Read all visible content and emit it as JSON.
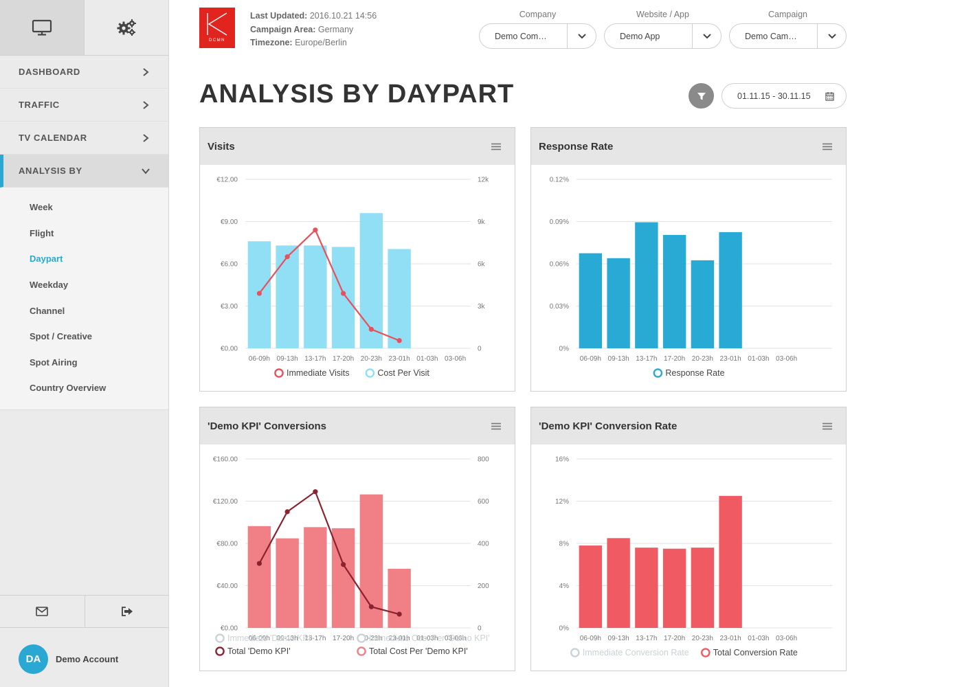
{
  "header": {
    "logo_text": "DCMN",
    "last_updated_label": "Last Updated:",
    "last_updated_value": "2016.10.21 14:56",
    "campaign_area_label": "Campaign Area:",
    "campaign_area_value": "Germany",
    "timezone_label": "Timezone:",
    "timezone_value": "Europe/Berlin",
    "selectors": [
      {
        "label": "Company",
        "value": "Demo Com…"
      },
      {
        "label": "Website / App",
        "value": "Demo App"
      },
      {
        "label": "Campaign",
        "value": "Demo Cam…"
      }
    ],
    "page_title": "ANALYSIS BY DAYPART",
    "date_range": "01.11.15 - 30.11.15"
  },
  "sidebar": {
    "nav": [
      {
        "label": "DASHBOARD"
      },
      {
        "label": "TRAFFIC"
      },
      {
        "label": "TV CALENDAR"
      },
      {
        "label": "ANALYSIS BY"
      }
    ],
    "sub": [
      "Week",
      "Flight",
      "Daypart",
      "Weekday",
      "Channel",
      "Spot / Creative",
      "Spot Airing",
      "Country Overview"
    ],
    "account_initials": "DA",
    "account_name": "Demo Account"
  },
  "colors": {
    "accent": "#29a8d4",
    "light_blue": "#90dff5",
    "blue": "#29aad4",
    "red_line": "#e8505b",
    "pink": "#f07f86",
    "dark_red": "#8b2230",
    "red": "#f05a63"
  },
  "chart_data": [
    {
      "type": "bar",
      "title": "Visits",
      "categories": [
        "06-09h",
        "09-13h",
        "13-17h",
        "17-20h",
        "20-23h",
        "23-01h",
        "01-03h",
        "03-06h"
      ],
      "yticks_left": [
        "€0.00",
        "€3.00",
        "€6.00",
        "€9.00",
        "€12.00"
      ],
      "yticks_right": [
        "0",
        "3k",
        "6k",
        "9k",
        "12k"
      ],
      "ylim_left": [
        0,
        12
      ],
      "ylim_right": [
        0,
        12000
      ],
      "series": [
        {
          "name": "Immediate Visits",
          "kind": "line",
          "axis": "left",
          "values": [
            3.9,
            6.5,
            8.4,
            3.9,
            1.35,
            0.55,
            null,
            null
          ]
        },
        {
          "name": "Cost Per Visit",
          "kind": "bar",
          "axis": "right",
          "values": [
            7600,
            7300,
            7300,
            7200,
            9600,
            7050,
            null,
            null
          ]
        }
      ],
      "legend": [
        {
          "name": "Immediate Visits",
          "active": true
        },
        {
          "name": "Cost Per Visit",
          "active": true
        }
      ]
    },
    {
      "type": "bar",
      "title": "Response Rate",
      "categories": [
        "06-09h",
        "09-13h",
        "13-17h",
        "17-20h",
        "20-23h",
        "23-01h",
        "01-03h",
        "03-06h"
      ],
      "yticks_left": [
        "0%",
        "0.03%",
        "0.06%",
        "0.09%",
        "0.12%"
      ],
      "ylim_left": [
        0,
        0.12
      ],
      "series": [
        {
          "name": "Response Rate",
          "kind": "bar",
          "axis": "left",
          "values": [
            0.0675,
            0.064,
            0.0895,
            0.0805,
            0.0625,
            0.0825,
            null,
            null
          ]
        }
      ],
      "legend": [
        {
          "name": "Response Rate",
          "active": true
        }
      ]
    },
    {
      "type": "bar",
      "title": "'Demo KPI' Conversions",
      "categories": [
        "06-09h",
        "09-13h",
        "13-17h",
        "17-20h",
        "20-23h",
        "23-01h",
        "01-03h",
        "03-06h"
      ],
      "yticks_left": [
        "€0.00",
        "€40.00",
        "€80.00",
        "€120.00",
        "€160.00"
      ],
      "yticks_right": [
        "0",
        "200",
        "400",
        "600",
        "800"
      ],
      "ylim_left": [
        0,
        160
      ],
      "ylim_right": [
        0,
        800
      ],
      "series": [
        {
          "name": "Total 'Demo KPI'",
          "kind": "bar",
          "axis": "right",
          "values": [
            482,
            424,
            477,
            472,
            632,
            280,
            null,
            null
          ]
        },
        {
          "name": "Total Cost Per 'Demo KPI'",
          "kind": "line",
          "axis": "left",
          "values": [
            61,
            110,
            129,
            60,
            20,
            13,
            null,
            null
          ]
        }
      ],
      "legend": [
        {
          "name": "Immediate 'Demo KPI'",
          "active": false
        },
        {
          "name": "Immediate Cost Per 'Demo KPI'",
          "active": false
        },
        {
          "name": "Total 'Demo KPI'",
          "active": true
        },
        {
          "name": "Total Cost Per 'Demo KPI'",
          "active": true
        }
      ]
    },
    {
      "type": "bar",
      "title": "'Demo KPI' Conversion Rate",
      "categories": [
        "06-09h",
        "09-13h",
        "13-17h",
        "17-20h",
        "20-23h",
        "23-01h",
        "01-03h",
        "03-06h"
      ],
      "yticks_left": [
        "0%",
        "4%",
        "8%",
        "12%",
        "16%"
      ],
      "ylim_left": [
        0,
        16
      ],
      "series": [
        {
          "name": "Total Conversion Rate",
          "kind": "bar",
          "axis": "left",
          "values": [
            7.8,
            8.5,
            7.6,
            7.5,
            7.6,
            12.5,
            null,
            null
          ]
        }
      ],
      "legend": [
        {
          "name": "Immediate Conversion Rate",
          "active": false
        },
        {
          "name": "Total Conversion Rate",
          "active": true
        }
      ]
    }
  ]
}
